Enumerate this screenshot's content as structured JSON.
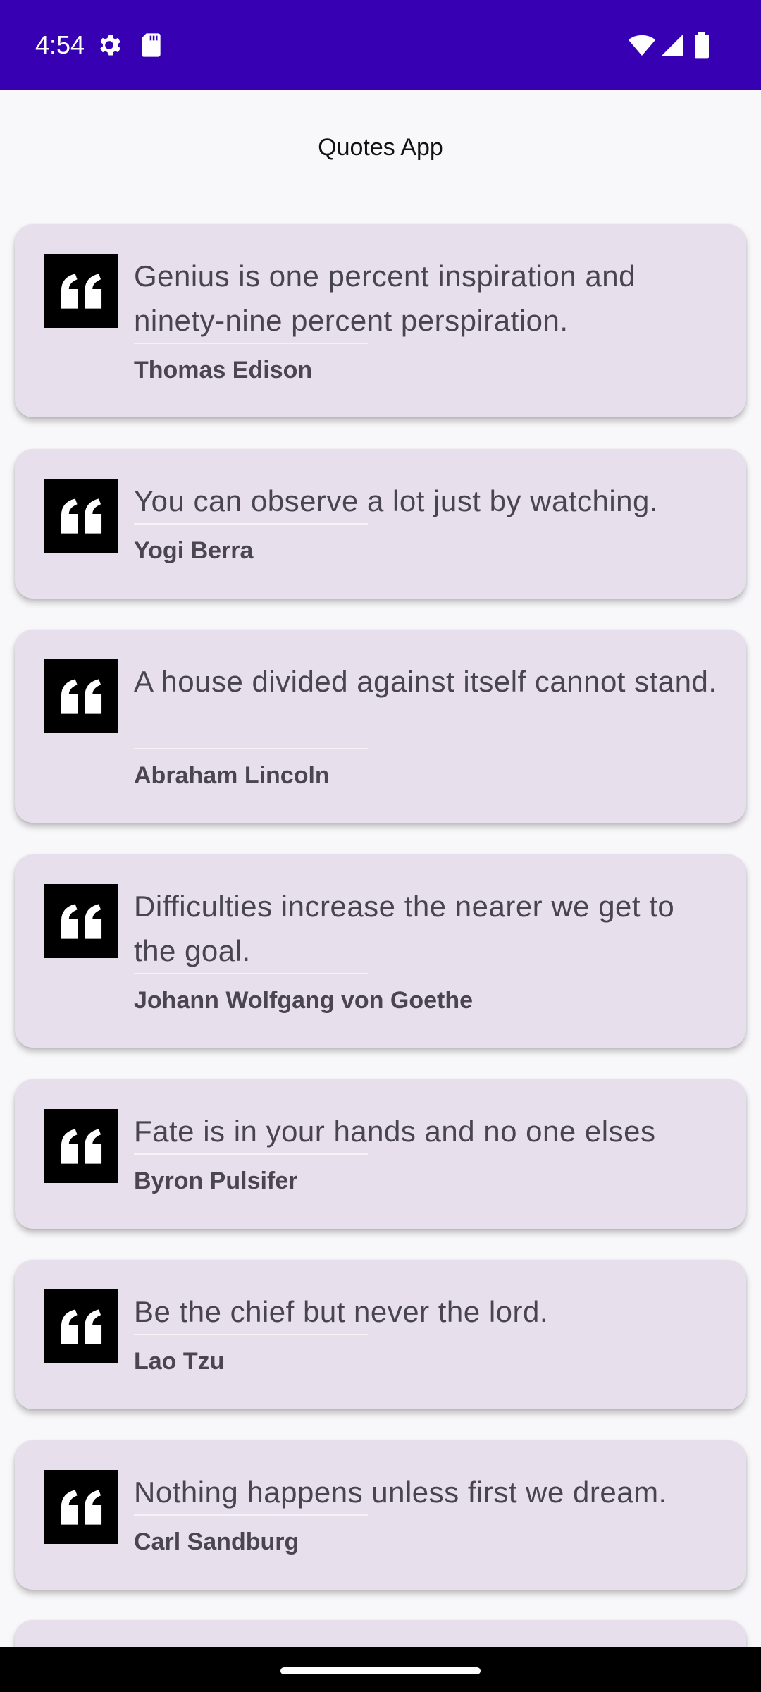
{
  "status_bar": {
    "time": "4:54",
    "background": "#3700b3",
    "left_icons": [
      "settings-icon",
      "sd-card-icon"
    ],
    "right_icons": [
      "wifi-icon",
      "cellular-signal-icon",
      "battery-icon"
    ]
  },
  "app": {
    "title": "Quotes App"
  },
  "colors": {
    "card_background": "#e7dfeb",
    "quote_icon_background": "#000000",
    "quote_text": "#49454f",
    "author_text": "#4a4550"
  },
  "quotes": [
    {
      "text": "Genius is one percent inspiration and ninety-nine percent perspiration.",
      "author": "Thomas Edison"
    },
    {
      "text": "You can observe a lot just by watching.",
      "author": "Yogi Berra"
    },
    {
      "text": "A house divided against itself cannot stand.",
      "author": "Abraham Lincoln"
    },
    {
      "text": "Difficulties increase the nearer we get to the goal.",
      "author": "Johann Wolfgang von Goethe"
    },
    {
      "text": "Fate is in your hands and no one elses",
      "author": "Byron Pulsifer"
    },
    {
      "text": "Be the chief but never the lord.",
      "author": "Lao Tzu"
    },
    {
      "text": "Nothing happens unless first we dream.",
      "author": "Carl Sandburg"
    }
  ],
  "navigation_bar": {
    "handle": "gesture-handle"
  }
}
